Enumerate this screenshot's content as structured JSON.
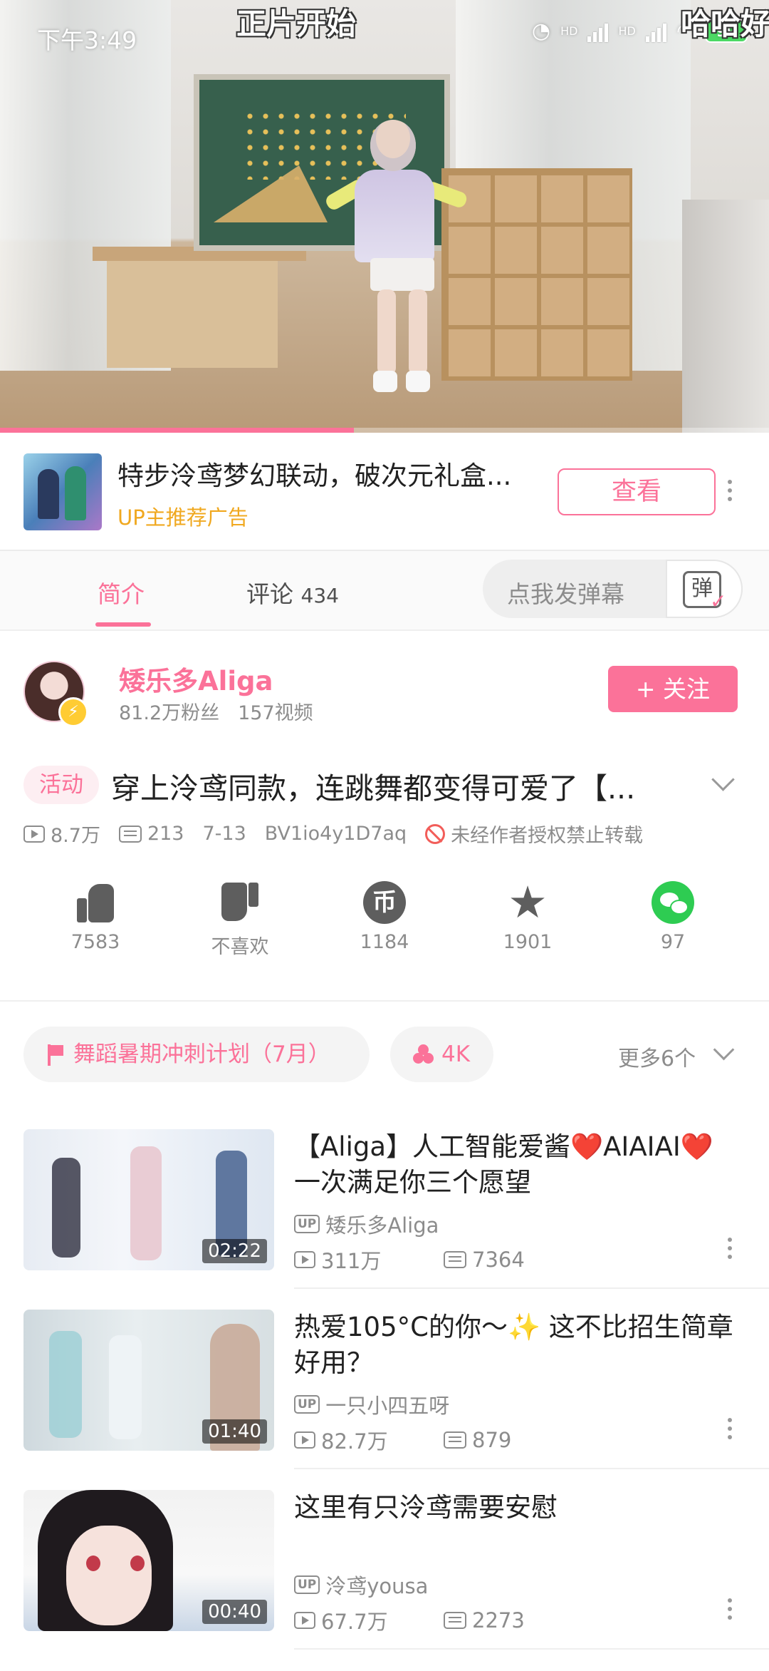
{
  "status_bar": {
    "time": "下午3:49",
    "signal_label": "HD",
    "battery": "99"
  },
  "video": {
    "danmaku": [
      "正片开始",
      "哈哈好"
    ],
    "progress_fraction": 0.46
  },
  "ad": {
    "title": "特步泠鸢梦幻联动，破次元礼盒...",
    "subtitle": "UP主推荐广告",
    "button": "查看"
  },
  "tabs": {
    "intro": "简介",
    "comments": "评论",
    "comment_count": "434",
    "danmaku_placeholder": "点我发弹幕",
    "danmaku_button": "弹"
  },
  "uploader": {
    "name": "矮乐多Aliga",
    "fans": "81.2万粉丝",
    "videos": "157视频",
    "follow": "+ 关注"
  },
  "video_info": {
    "tag": "活动",
    "title": "穿上泠鸢同款，连跳舞都变得可爱了【...",
    "views": "8.7万",
    "danmaku": "213",
    "date": "7-13",
    "bvid": "BV1io4y1D7aq",
    "notice": "未经作者授权禁止转载"
  },
  "actions": {
    "like": "7583",
    "dislike": "不喜欢",
    "coin": "1184",
    "coin_glyph": "币",
    "favorite": "1901",
    "share": "97"
  },
  "chips": {
    "event": "舞蹈暑期冲刺计划（7月）",
    "count": "4K",
    "more": "更多6个"
  },
  "related": [
    {
      "title": "【Aliga】人工智能爱酱❤️AIAIAI❤️一次满足你三个愿望",
      "up": "矮乐多Aliga",
      "views": "311万",
      "danmaku": "7364",
      "duration": "02:22"
    },
    {
      "title": "热爱105°C的你～✨ 这不比招生简章好用？",
      "up": "一只小四五呀",
      "views": "82.7万",
      "danmaku": "879",
      "duration": "01:40"
    },
    {
      "title": "这里有只泠鸢需要安慰",
      "up": "泠鸢yousa",
      "views": "67.7万",
      "danmaku": "2273",
      "duration": "00:40"
    }
  ],
  "colors": {
    "accent": "#fb7299",
    "ad_subtitle": "#f0a81f",
    "wechat": "#2ecc52",
    "board": "#37604d"
  }
}
